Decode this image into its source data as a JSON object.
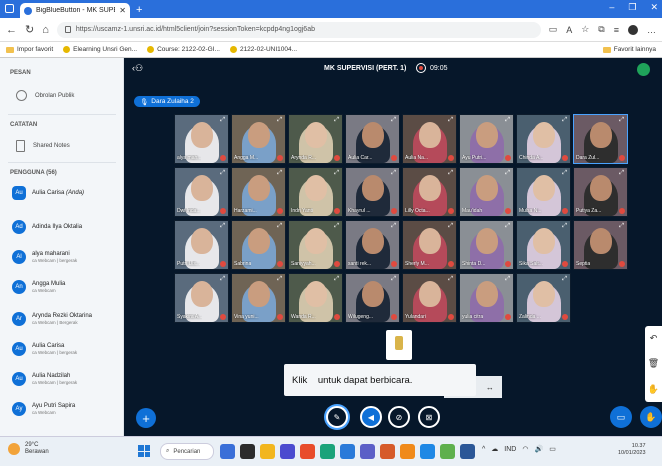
{
  "browser": {
    "tab_title": "BigBlueButton - MK SUPERV...",
    "url": "https://uscamz-1.unsri.ac.id/html5client/join?sessionToken=kcpdp4ng1ogj6ab",
    "bookmarks": [
      "Impor favorit",
      "Elearning Unsri Gen...",
      "Course: 2122-02-GI...",
      "2122-02-UNI1004..."
    ],
    "bookmark_folder": "Favorit lainnya"
  },
  "sidebar": {
    "messages_header": "PESAN",
    "public_chat": "Obrolan Publik",
    "notes_header": "CATATAN",
    "shared_notes": "Shared Notes",
    "users_header": "PENGGUNA (56)",
    "users": [
      {
        "initials": "Au",
        "name": "Aulia Carisa",
        "tag": "(Anda)",
        "meta": ""
      },
      {
        "initials": "Ad",
        "name": "Adinda Ilya Oktalia",
        "tag": "",
        "meta": ""
      },
      {
        "initials": "Al",
        "name": "alya maharani",
        "tag": "",
        "meta": "ca Webcam | bergerak"
      },
      {
        "initials": "An",
        "name": "Angga Mulia",
        "tag": "",
        "meta": "ca Webcam"
      },
      {
        "initials": "Ar",
        "name": "Arynda Rezki Oktarina",
        "tag": "",
        "meta": "ca Webcam | Bergerak"
      },
      {
        "initials": "Au",
        "name": "Aulia Carisa",
        "tag": "",
        "meta": "ca Webcam | bergerak"
      },
      {
        "initials": "Au",
        "name": "Aulia Nadzilah",
        "tag": "",
        "meta": "ca Webcam | bergerak"
      },
      {
        "initials": "Ay",
        "name": "Ayu Putri Sapira",
        "tag": "",
        "meta": "ca Webcam"
      }
    ]
  },
  "meeting": {
    "title": "MK SUPERVISI (PERT. 1)",
    "timer": "09:05",
    "talking": "Dara Zulaiha 2",
    "webcams": [
      "alya mah...",
      "Angga M...",
      "Arynda R...",
      "Aulia Car...",
      "Aulia Na...",
      "Ayu Putri...",
      "Chinda A...",
      "Dara Zul...",
      "Dwi Inda...",
      "Harzami...",
      "Indri Yanti",
      "Khayrul ...",
      "Lilly Octa...",
      "Mau'idah",
      "Mulsa N...",
      "Putiya Za...",
      "Putri Uls...",
      "Sabrina",
      "Saniyyah...",
      "santi rek...",
      "Sherly M...",
      "Shinta D...",
      "Sika Salt...",
      "Septia",
      "Syakira A...",
      "Vina yuni...",
      "Wanda R...",
      "Wilugeng...",
      "Yulandari",
      "yulia citra",
      "Zalinda ..."
    ],
    "toast": "Klik    untuk dapat berbicara.",
    "zoom": "%"
  },
  "taskbar": {
    "weather_temp": "29°C",
    "weather_desc": "Berawan",
    "search_placeholder": "Pencarian",
    "lang": "IND",
    "time": "10.37",
    "date": "10/01/2023"
  },
  "colors": {
    "accent": "#0f70d7",
    "main_bg": "#06172a",
    "tab_bar": "#2a6fdb",
    "recording": "#e04a3f"
  }
}
